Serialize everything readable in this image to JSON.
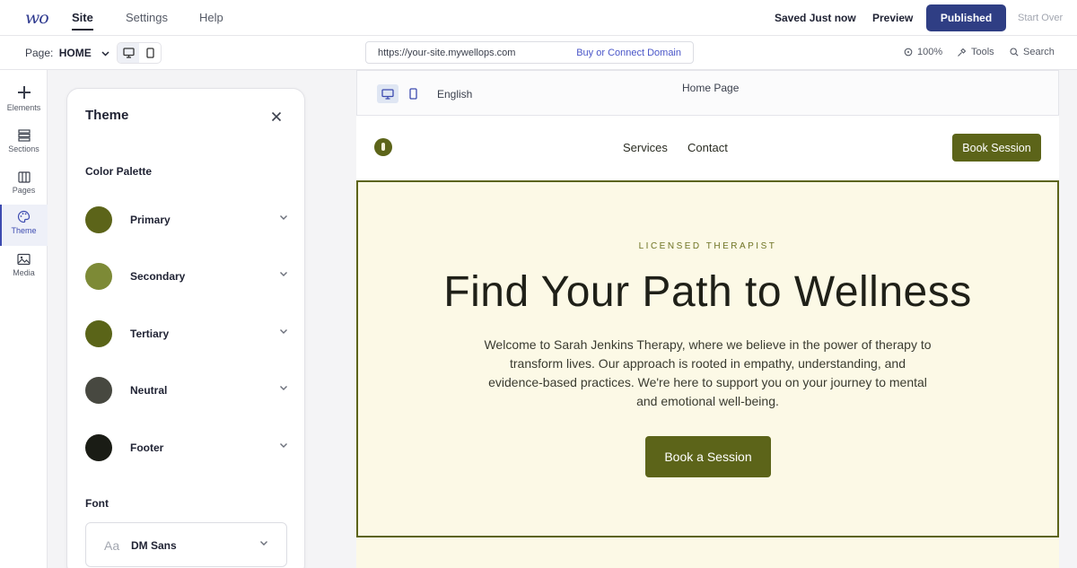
{
  "app": {
    "logo": "wo",
    "nav": [
      "Site",
      "Settings",
      "Help"
    ],
    "status": "Saved Just now",
    "preview_label": "Preview",
    "published_label": "Published",
    "start_over_label": "Start Over"
  },
  "subbar": {
    "page_prefix": "Page:",
    "page_name": "HOME",
    "url": "https://your-site.mywellops.com",
    "domain_link": "Buy or Connect Domain",
    "zoom": "100%",
    "tools_label": "Tools",
    "search_label": "Search"
  },
  "rail": {
    "items": [
      {
        "label": "Elements",
        "icon": "plus-icon"
      },
      {
        "label": "Sections",
        "icon": "sections-icon"
      },
      {
        "label": "Pages",
        "icon": "pages-icon"
      },
      {
        "label": "Theme",
        "icon": "palette-icon"
      },
      {
        "label": "Media",
        "icon": "image-icon"
      }
    ],
    "active": "Theme"
  },
  "theme_panel": {
    "title": "Theme",
    "color_palette_label": "Color Palette",
    "colors": [
      {
        "name": "Primary",
        "hex": "#5c6419"
      },
      {
        "name": "Secondary",
        "hex": "#7d8a36"
      },
      {
        "name": "Tertiary",
        "hex": "#5a6418"
      },
      {
        "name": "Neutral",
        "hex": "#474840"
      },
      {
        "name": "Footer",
        "hex": "#1a1c15"
      }
    ],
    "font_label": "Font",
    "font_sample": "Aa",
    "font_name": "DM Sans"
  },
  "preview": {
    "language": "English",
    "page_title": "Home Page",
    "site_nav": {
      "links": [
        "Services",
        "Contact"
      ],
      "cta": "Book Session"
    },
    "hero": {
      "eyebrow": "LICENSED THERAPIST",
      "title": "Find Your Path to Wellness",
      "body": "Welcome to Sarah Jenkins Therapy, where we believe in the power of therapy to transform lives. Our approach is rooted in empathy, understanding, and evidence-based practices. We're here to support you on your journey to mental and emotional well-being.",
      "cta": "Book a Session"
    }
  },
  "colors": {
    "brand_blue": "#2f3e84",
    "accent_olive": "#5c6419",
    "hero_bg": "#fcf9e6"
  }
}
